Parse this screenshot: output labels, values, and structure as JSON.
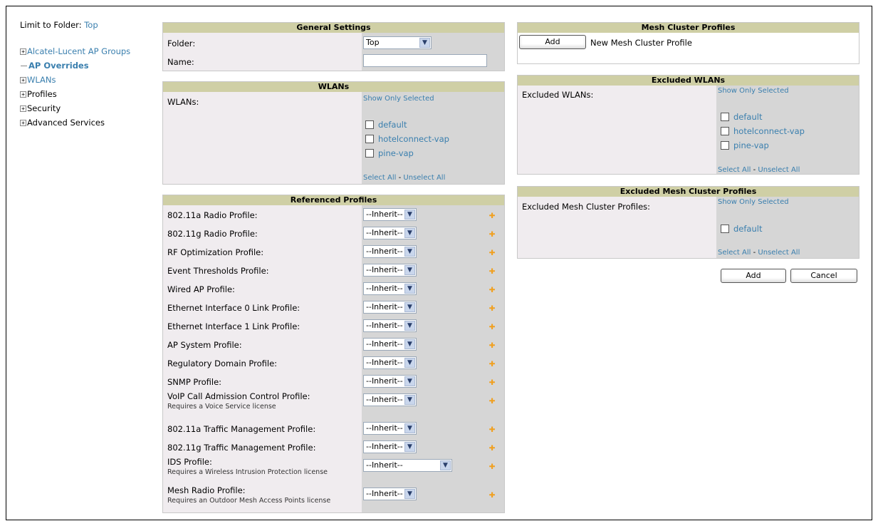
{
  "nav": {
    "limit_label": "Limit to Folder:",
    "limit_folder": "Top",
    "items": [
      {
        "label": "Alcatel-Lucent AP Groups",
        "expander": "+"
      },
      {
        "label": "AP Overrides",
        "expander": "-"
      },
      {
        "label": "WLANs",
        "expander": "+"
      },
      {
        "label": "Profiles",
        "expander": "+"
      },
      {
        "label": "Security",
        "expander": "+"
      },
      {
        "label": "Advanced Services",
        "expander": "+"
      }
    ]
  },
  "general": {
    "title": "General Settings",
    "folder_label": "Folder:",
    "folder_value": "Top",
    "name_label": "Name:",
    "name_value": ""
  },
  "wlans": {
    "title": "WLANs",
    "label": "WLANs:",
    "show_only": "Show Only Selected",
    "options": [
      "default",
      "hotelconnect-vap",
      "pine-vap"
    ],
    "select_all": "Select All",
    "sep": " - ",
    "unselect_all": "Unselect All"
  },
  "ref_profiles": {
    "title": "Referenced Profiles",
    "items": [
      {
        "label": "802.11a Radio Profile:",
        "note": "",
        "value": "--Inherit--"
      },
      {
        "label": "802.11g Radio Profile:",
        "note": "",
        "value": "--Inherit--"
      },
      {
        "label": "RF Optimization Profile:",
        "note": "",
        "value": "--Inherit--"
      },
      {
        "label": "Event Thresholds Profile:",
        "note": "",
        "value": "--Inherit--"
      },
      {
        "label": "Wired AP Profile:",
        "note": "",
        "value": "--Inherit--"
      },
      {
        "label": "Ethernet Interface 0 Link Profile:",
        "note": "",
        "value": "--Inherit--"
      },
      {
        "label": "Ethernet Interface 1 Link Profile:",
        "note": "",
        "value": "--Inherit--"
      },
      {
        "label": "AP System Profile:",
        "note": "",
        "value": "--Inherit--"
      },
      {
        "label": "Regulatory Domain Profile:",
        "note": "",
        "value": "--Inherit--"
      },
      {
        "label": "SNMP Profile:",
        "note": "",
        "value": "--Inherit--"
      },
      {
        "label": "VoIP Call Admission Control Profile:",
        "note": "Requires a Voice Service license",
        "value": "--Inherit--"
      },
      {
        "label": "802.11a Traffic Management Profile:",
        "note": "",
        "value": "--Inherit--"
      },
      {
        "label": "802.11g Traffic Management Profile:",
        "note": "",
        "value": "--Inherit--"
      },
      {
        "label": "IDS Profile:",
        "note": "Requires a Wireless Intrusion Protection license",
        "value": "--Inherit--"
      },
      {
        "label": "Mesh Radio Profile:",
        "note": "Requires an Outdoor Mesh Access Points license",
        "value": "--Inherit--"
      }
    ]
  },
  "mesh_cluster": {
    "title": "Mesh Cluster Profiles",
    "add_label": "Add",
    "new_label": "New Mesh Cluster Profile"
  },
  "excluded_wlans": {
    "title": "Excluded WLANs",
    "label": "Excluded WLANs:",
    "show_only": "Show Only Selected",
    "options": [
      "default",
      "hotelconnect-vap",
      "pine-vap"
    ],
    "select_all": "Select All",
    "sep": " - ",
    "unselect_all": "Unselect All"
  },
  "excluded_mesh": {
    "title": "Excluded Mesh Cluster Profiles",
    "label": "Excluded Mesh Cluster Profiles:",
    "show_only": "Show Only Selected",
    "options": [
      "default"
    ],
    "select_all": "Select All",
    "sep": " - ",
    "unselect_all": "Unselect All"
  },
  "actions": {
    "add": "Add",
    "cancel": "Cancel"
  },
  "colors": {
    "link": "#3a7fae",
    "header": "#cfcfa5",
    "panel_bg": "#f0ecef",
    "gray_col": "#d6d6d6",
    "plus_icon": "#f0a020"
  }
}
